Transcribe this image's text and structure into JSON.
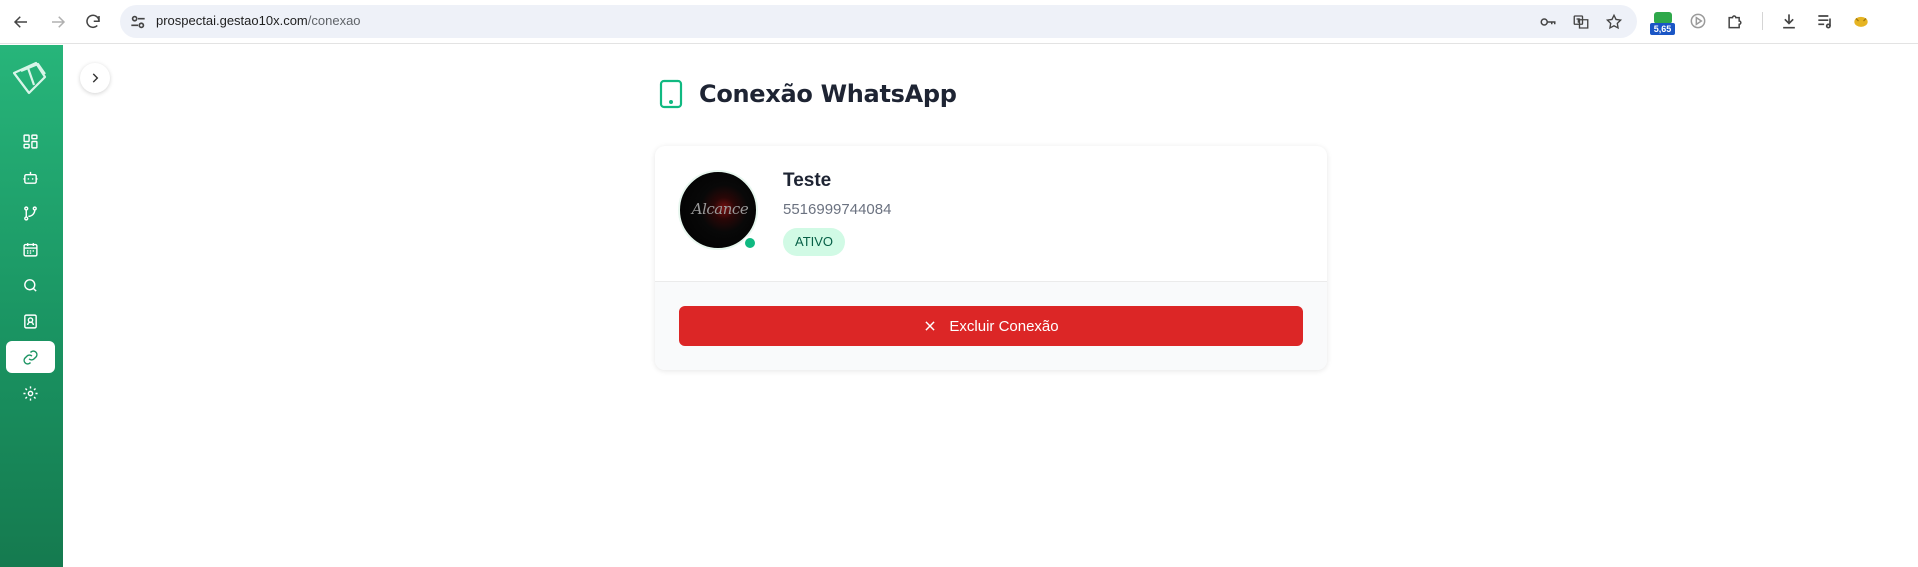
{
  "browser": {
    "url_host": "prospectai.gestao10x.com",
    "url_path": "/conexao",
    "extension_badge": "5,65",
    "icons": [
      "back-icon",
      "forward-icon",
      "reload-icon",
      "site-settings-icon",
      "password-key-icon",
      "translate-icon",
      "bookmark-star-icon",
      "extension-badge-icon",
      "extension-icon",
      "extensions-puzzle-icon",
      "download-icon",
      "media-controls-icon",
      "profile-icon"
    ]
  },
  "sidebar": {
    "items": [
      {
        "name": "dashboard",
        "icon": "grid-icon",
        "active": false
      },
      {
        "name": "bots",
        "icon": "robot-icon",
        "active": false
      },
      {
        "name": "flows",
        "icon": "git-branch-icon",
        "active": false
      },
      {
        "name": "calendar",
        "icon": "calendar-icon",
        "active": false
      },
      {
        "name": "search",
        "icon": "search-icon",
        "active": false
      },
      {
        "name": "contacts",
        "icon": "contact-card-icon",
        "active": false
      },
      {
        "name": "connection",
        "icon": "link-icon",
        "active": true
      },
      {
        "name": "settings",
        "icon": "gear-icon",
        "active": false
      }
    ]
  },
  "page": {
    "title": "Conexão WhatsApp"
  },
  "connection": {
    "name": "Teste",
    "phone": "5516999744084",
    "status": "ATIVO",
    "avatar_text": "Alcance",
    "delete_label": "Excluir Conexão"
  },
  "colors": {
    "accent": "#1a9462",
    "danger": "#dc2626",
    "badge_bg": "#d1fae5",
    "online": "#10b981"
  }
}
